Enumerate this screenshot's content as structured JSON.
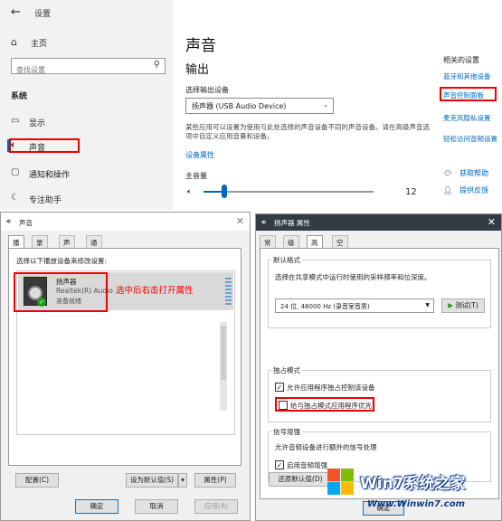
{
  "settings": {
    "window_title": "设置",
    "home": "主页",
    "search_placeholder": "查找设置",
    "system_header": "系统",
    "nav": [
      {
        "label": "显示"
      },
      {
        "label": "声音"
      },
      {
        "label": "通知和操作"
      },
      {
        "label": "专注助手"
      }
    ],
    "page_title": "声音",
    "output_header": "输出",
    "choose_output_label": "选择输出设备",
    "output_device": "扬声器 (USB Audio Device)",
    "description": "某些应用可以设置为使用与此处选择的声音设备不同的声音设备。请在高级声音选项中自定义应用音量和设备。",
    "device_properties_link": "设备属性",
    "master_volume_label": "主音量",
    "volume_value": "12",
    "volume_level": 0.12,
    "related_header": "相关的设置",
    "related_links": [
      "蓝牙和其他设备",
      "声音控制面板",
      "麦克风隐私设置",
      "轻松访问音频设置"
    ],
    "help": [
      "获取帮助",
      "提供反馈"
    ]
  },
  "sound_dialog": {
    "title": "声音",
    "tabs": [
      "播放",
      "录制",
      "声音",
      "通信"
    ],
    "prompt": "选择以下播放设备来修改设置:",
    "device": {
      "name": "扬声器",
      "driver": "Realtek(R) Audio",
      "status": "准备就绪"
    },
    "annotation": "选中后右击打开属性",
    "configure": "配置(C)",
    "set_default": "设为默认值(S)",
    "properties": "属性(P)",
    "ok": "确定",
    "cancel": "取消",
    "apply": "应用(A)"
  },
  "props_dialog": {
    "title": "扬声器 属性",
    "tabs": [
      "常规",
      "级别",
      "高级",
      "空间音效"
    ],
    "default_format_header": "默认格式",
    "default_format_desc": "选择在共享模式中运行时使用的采样频率和位深度。",
    "format_value": "24 位, 48000 Hz (录音室音质)",
    "test_button": "测试(T)",
    "exclusive_header": "独占模式",
    "allow_exclusive": "允许应用程序独占控制该设备",
    "give_priority": "给与独占模式应用程序优先",
    "enhance_header": "信号增强",
    "enhance_desc": "允许音频设备进行额外的信号处理",
    "enable_enhance": "启用音频增强",
    "restore_defaults": "还原默认值(D)",
    "ok": "确定"
  },
  "watermark": {
    "brand": "Win7系统之家",
    "url": "Www.Winwin7.com"
  }
}
